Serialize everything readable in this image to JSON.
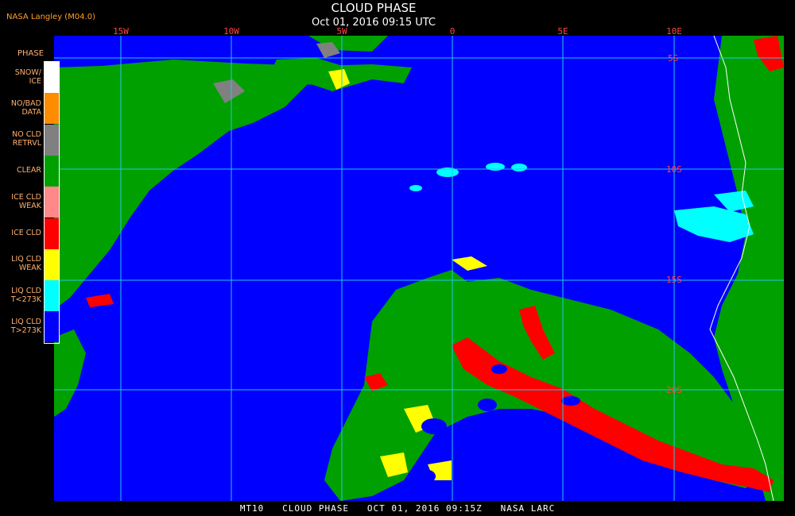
{
  "header": {
    "title": "CLOUD PHASE",
    "datetime": "Oct 01, 2016 09:15 UTC",
    "provider": "NASA Langley (M04.0)"
  },
  "legend": {
    "title": "PHASE",
    "items": [
      {
        "line1": "SNOW/",
        "line2": "ICE",
        "color": "#ffffff"
      },
      {
        "line1": "NO/BAD",
        "line2": "DATA",
        "color": "#ff8c00"
      },
      {
        "line1": "NO CLD",
        "line2": "RETRVL",
        "color": "#808080"
      },
      {
        "line1": "CLEAR",
        "line2": "",
        "color": "#00a000"
      },
      {
        "line1": "ICE CLD",
        "line2": "WEAK",
        "color": "#ff8888"
      },
      {
        "line1": "ICE CLD",
        "line2": "",
        "color": "#ff0000"
      },
      {
        "line1": "LIQ CLD",
        "line2": "WEAK",
        "color": "#ffff00"
      },
      {
        "line1": "LIQ CLD",
        "line2": "T<273K",
        "color": "#00ffff"
      },
      {
        "line1": "LIQ CLD",
        "line2": "T>273K",
        "color": "#0000ff"
      }
    ]
  },
  "grid": {
    "lon_labels": [
      "15W",
      "10W",
      "5W",
      "0",
      "5E",
      "10E"
    ],
    "lat_labels": [
      "5S",
      "10S",
      "15S",
      "20S"
    ],
    "grid_color": "#22c8e6"
  },
  "footer": "MT10   CLOUD PHASE   OCT 01, 2016 09:15Z   NASA LARC"
}
